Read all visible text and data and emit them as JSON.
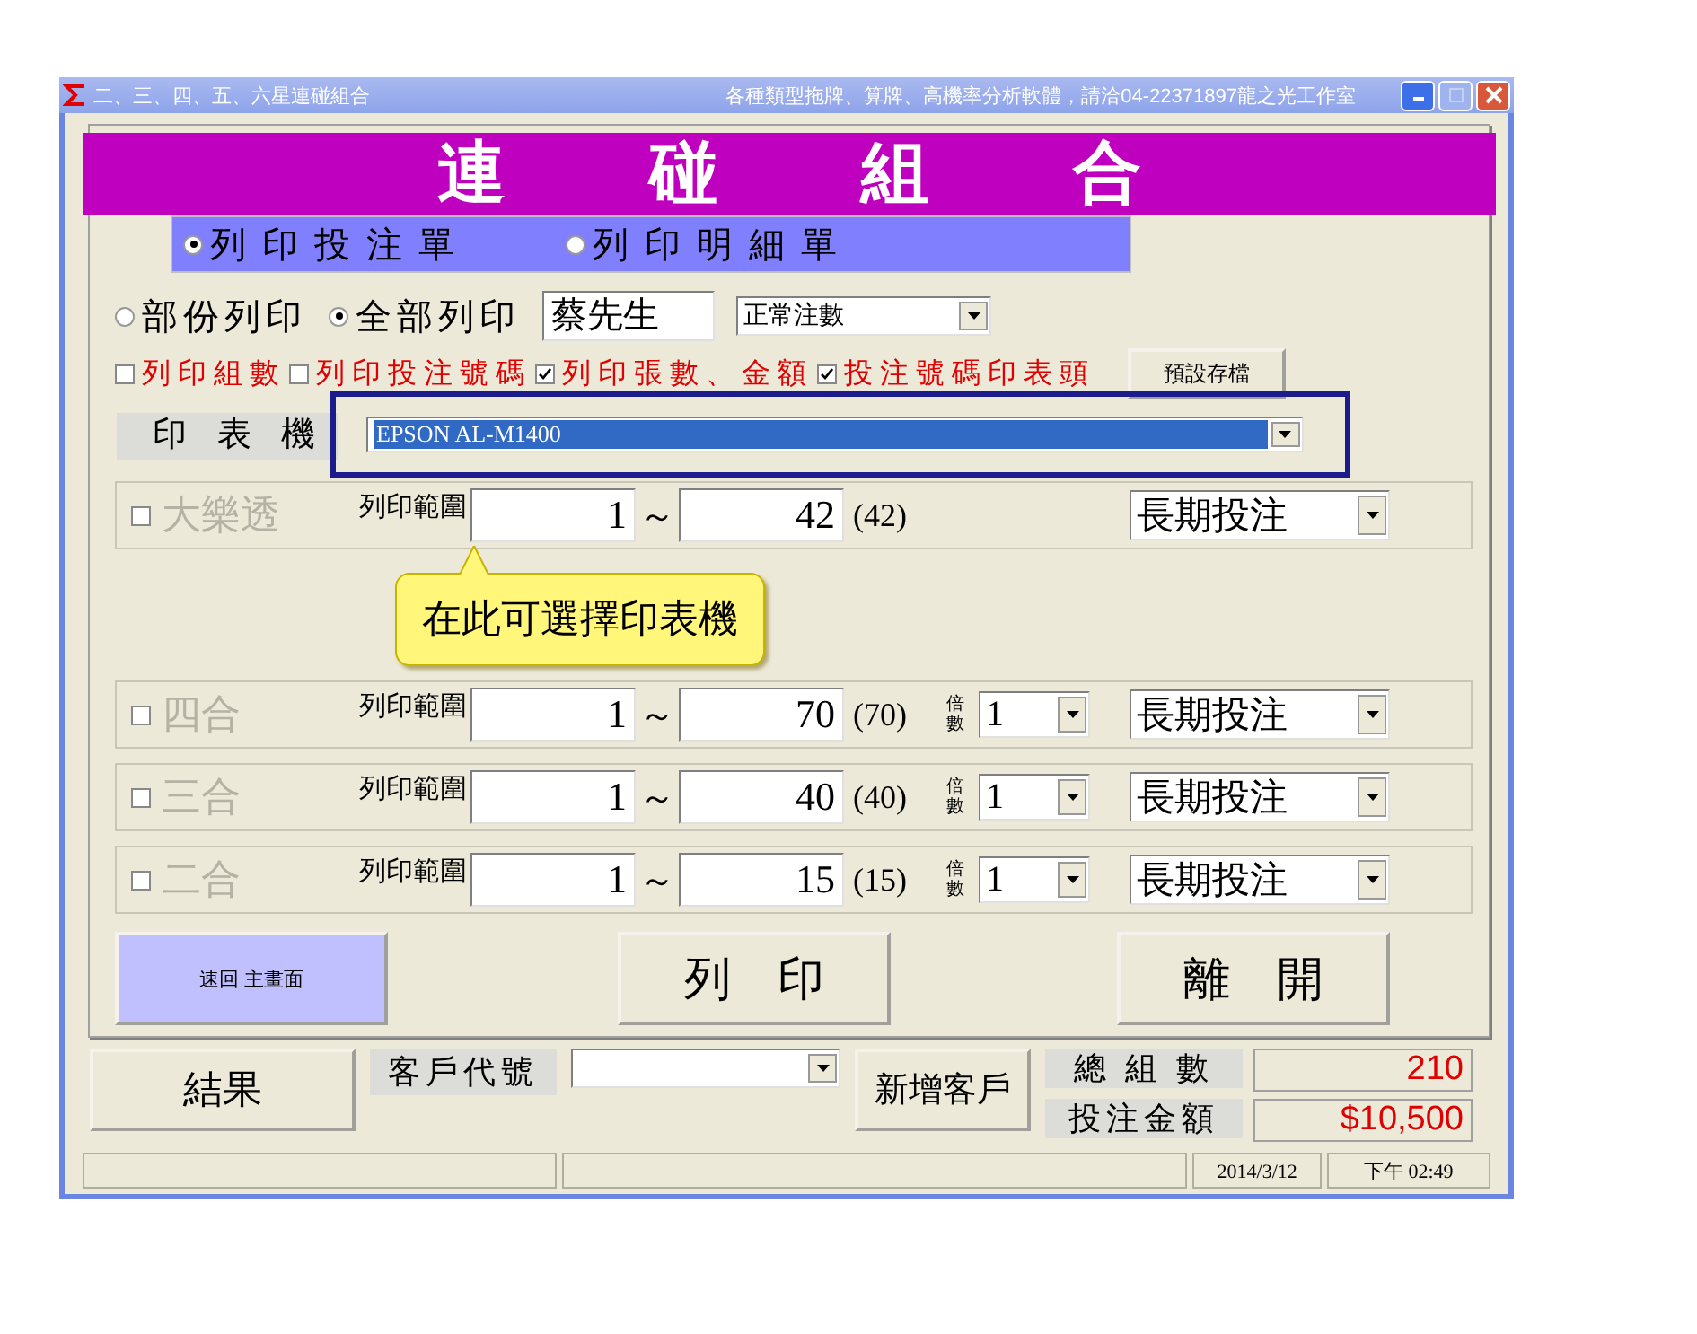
{
  "window": {
    "title": "二、三、四、五、六星連碰組合",
    "subtitle": "各種類型拖牌、算牌、高機率分析軟體，請洽04-22371897龍之光工作室"
  },
  "banner": {
    "title": "連碰組合"
  },
  "print_mode": [
    {
      "label": "列 印 投 注 單",
      "selected": true
    },
    {
      "label": "列 印 明 細 單",
      "selected": false
    }
  ],
  "scope": [
    {
      "label": "部份列印",
      "selected": false
    },
    {
      "label": "全部列印",
      "selected": true
    }
  ],
  "customer_name": "蔡先生",
  "bet_type": "正常注數",
  "options": [
    {
      "label": "列印組數",
      "checked": false
    },
    {
      "label": "列印投注號碼",
      "checked": false
    },
    {
      "label": "列印張數、金額",
      "checked": true
    },
    {
      "label": "投注號碼印表頭",
      "checked": true
    }
  ],
  "save_default_button": "預設存檔",
  "printer": {
    "label": "印 表 機",
    "value": "EPSON AL-M1400"
  },
  "callout": "在此可選擇印表機",
  "games": [
    {
      "name": "大樂透",
      "checked": false,
      "disabled": true,
      "range_label": "列印範圍",
      "from": "1",
      "to": "42",
      "total": "(42)",
      "bet_mode": "長期投注"
    },
    {
      "name": "四合",
      "checked": false,
      "disabled": true,
      "range_label": "列印範圍",
      "from": "1",
      "to": "70",
      "total": "(70)",
      "multiplier_label": "倍數",
      "multiplier": "1",
      "bet_mode": "長期投注"
    },
    {
      "name": "三合",
      "checked": false,
      "disabled": true,
      "range_label": "列印範圍",
      "from": "1",
      "to": "40",
      "total": "(40)",
      "multiplier_label": "倍數",
      "multiplier": "1",
      "bet_mode": "長期投注"
    },
    {
      "name": "二合",
      "checked": false,
      "disabled": true,
      "range_label": "列印範圍",
      "from": "1",
      "to": "15",
      "total": "(15)",
      "multiplier_label": "倍數",
      "multiplier": "1",
      "bet_mode": "長期投注"
    }
  ],
  "range_separator": "～",
  "buttons": {
    "back": "速回 主畫面",
    "print": "列　印",
    "exit": "離　開"
  },
  "bottom": {
    "result_button": "結果",
    "customer_code_label": "客戶代號",
    "add_customer_button": "新增客戶",
    "total_groups_label": "總 組 數",
    "total_groups": "210",
    "amount_label": "投注金額",
    "amount": "$10,500"
  },
  "status_bar": {
    "date": "2014/3/12",
    "time": "下午 02:49"
  }
}
